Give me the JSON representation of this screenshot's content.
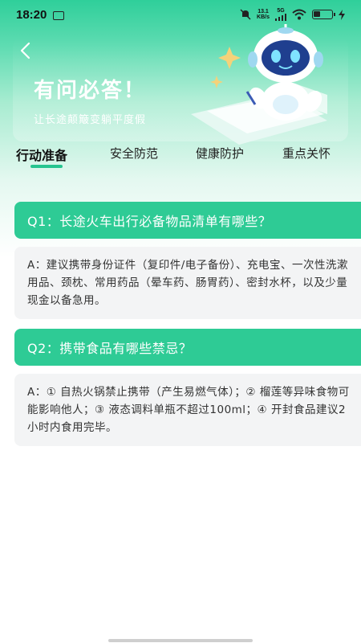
{
  "status_bar": {
    "time": "18:20",
    "net_speed_value": "13.1",
    "net_speed_unit": "KB/s",
    "signal_label": "5G"
  },
  "banner": {
    "title": "有问必答！",
    "subtitle": "让长途颠簸变躺平度假"
  },
  "tabs": [
    {
      "label": "行动准备",
      "active": true
    },
    {
      "label": "安全防范",
      "active": false
    },
    {
      "label": "健康防护",
      "active": false
    },
    {
      "label": "重点关怀",
      "active": false
    }
  ],
  "qa": [
    {
      "question": "Q1：长途火车出行必备物品清单有哪些？",
      "answer": "A：建议携带身份证件（复印件/电子备份）、充电宝、一次性洗漱用品、颈枕、常用药品（晕车药、肠胃药）、密封水杯，以及少量现金以备急用。"
    },
    {
      "question": "Q2：携带食品有哪些禁忌？",
      "answer": "A：① 自热火锅禁止携带（产生易燃气体）；② 榴莲等异味食物可能影响他人；③ 液态调料单瓶不超过100ml；④ 开封食品建议2小时内食用完毕。"
    }
  ],
  "colors": {
    "accent": "#2ecb95",
    "answer_bg": "#f3f4f5"
  },
  "icons": {
    "back": "chevron-left-icon",
    "robot": "robot-mascot-icon"
  }
}
